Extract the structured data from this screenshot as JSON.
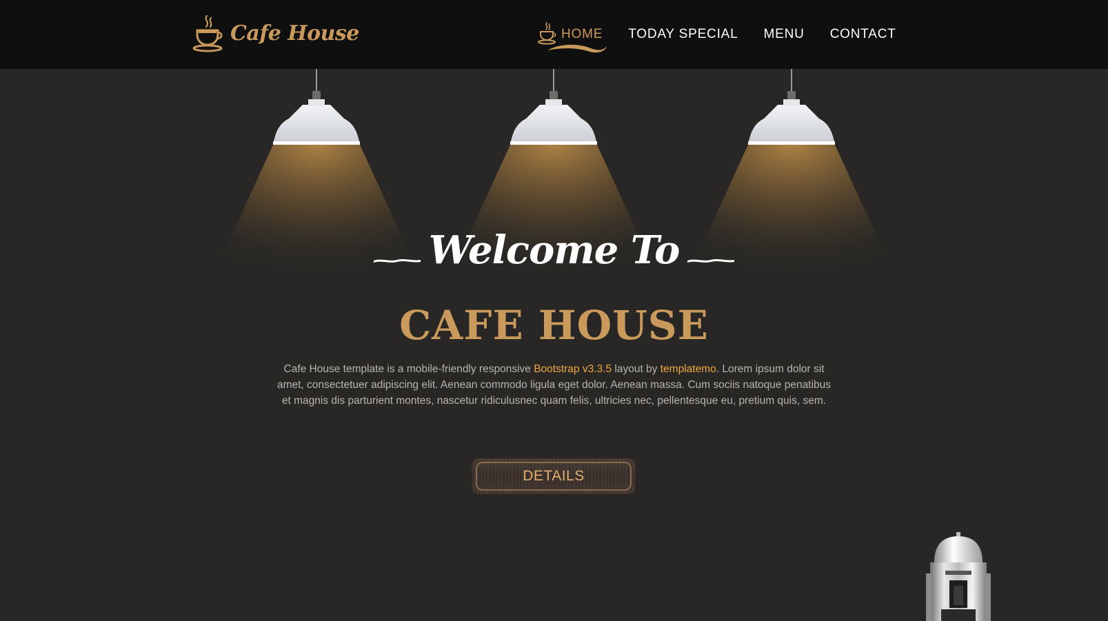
{
  "logo": {
    "text": "Cafe House",
    "icon": "coffee-cup-icon"
  },
  "nav": {
    "items": [
      {
        "label": "HOME",
        "active": true,
        "icon": "coffee-cup-icon"
      },
      {
        "label": "TODAY SPECIAL",
        "active": false
      },
      {
        "label": "MENU",
        "active": false
      },
      {
        "label": "CONTACT",
        "active": false
      }
    ]
  },
  "hero": {
    "welcome": "Welcome To",
    "title": "CAFE HOUSE",
    "description": {
      "part1": "Cafe House template is a mobile-friendly responsive ",
      "link1": "Bootstrap v3.3.5",
      "part2": " layout by ",
      "link2": "templatemo",
      "part3": ". Lorem ipsum dolor sit amet, consectetuer adipiscing elit. Aenean commodo ligula eget dolor. Aenean massa. Cum sociis natoque penatibus et magnis dis parturient montes, nascetur ridiculusnec quam felis, ultricies nec, pellentesque eu, pretium quis, sem."
    },
    "button_label": "DETAILS"
  },
  "decor": {
    "lamps": [
      "pendant-lamp-icon",
      "pendant-lamp-icon",
      "pendant-lamp-icon"
    ],
    "machine": "coffee-machine-icon"
  },
  "colors": {
    "header_bg": "#0f0f0f",
    "page_bg": "#282725",
    "accent": "#c99a5b",
    "link": "#f0a840",
    "text": "#b9b4ad"
  }
}
